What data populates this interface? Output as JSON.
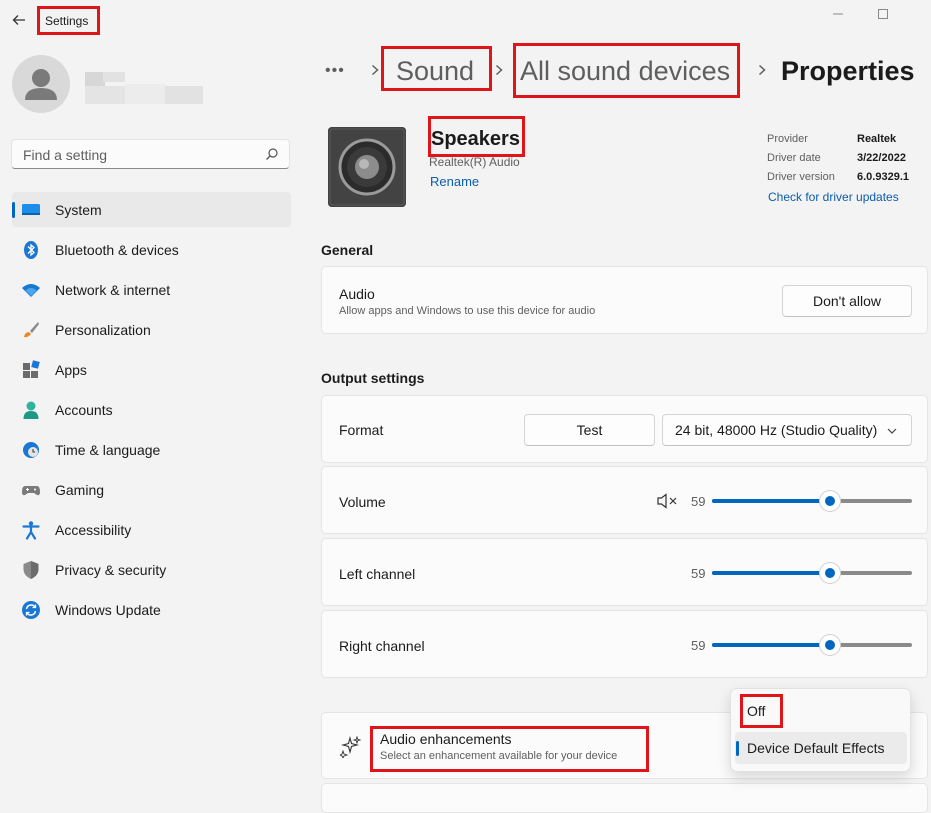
{
  "window": {
    "title": "Settings"
  },
  "search": {
    "placeholder": "Find a setting"
  },
  "sidebar": {
    "items": [
      {
        "label": "System",
        "icon": "system-display-icon"
      },
      {
        "label": "Bluetooth & devices",
        "icon": "bluetooth-icon"
      },
      {
        "label": "Network & internet",
        "icon": "wifi-icon"
      },
      {
        "label": "Personalization",
        "icon": "brush-icon"
      },
      {
        "label": "Apps",
        "icon": "apps-icon"
      },
      {
        "label": "Accounts",
        "icon": "account-icon"
      },
      {
        "label": "Time & language",
        "icon": "clock-globe-icon"
      },
      {
        "label": "Gaming",
        "icon": "gamepad-icon"
      },
      {
        "label": "Accessibility",
        "icon": "accessibility-icon"
      },
      {
        "label": "Privacy & security",
        "icon": "shield-icon"
      },
      {
        "label": "Windows Update",
        "icon": "update-icon"
      }
    ],
    "selected": "System"
  },
  "breadcrumb": {
    "overflow": "•••",
    "items": [
      "Sound",
      "All sound devices",
      "Properties"
    ]
  },
  "device": {
    "name": "Speakers",
    "subtitle": "Realtek(R) Audio",
    "rename_label": "Rename",
    "driver": {
      "provider_label": "Provider",
      "provider_value": "Realtek",
      "date_label": "Driver date",
      "date_value": "3/22/2022",
      "version_label": "Driver version",
      "version_value": "6.0.9329.1",
      "check_link": "Check for driver updates"
    }
  },
  "general": {
    "heading": "General",
    "audio": {
      "title": "Audio",
      "description": "Allow apps and Windows to use this device for audio",
      "button": "Don't allow"
    }
  },
  "output": {
    "heading": "Output settings",
    "format": {
      "label": "Format",
      "test_button": "Test",
      "selected_format": "24 bit, 48000 Hz (Studio Quality)"
    },
    "volume": {
      "label": "Volume",
      "value": "59",
      "level": 0.59
    },
    "left_channel": {
      "label": "Left channel",
      "value": "59",
      "level": 0.59
    },
    "right_channel": {
      "label": "Right channel",
      "value": "59",
      "level": 0.59
    }
  },
  "enhancements": {
    "title": "Audio enhancements",
    "description": "Select an enhancement available for your device",
    "menu_options": [
      "Off",
      "Device Default Effects"
    ],
    "selected_option": "Device Default Effects"
  },
  "colors": {
    "accent": "#0067c0",
    "highlight_box": "#e0151a"
  }
}
